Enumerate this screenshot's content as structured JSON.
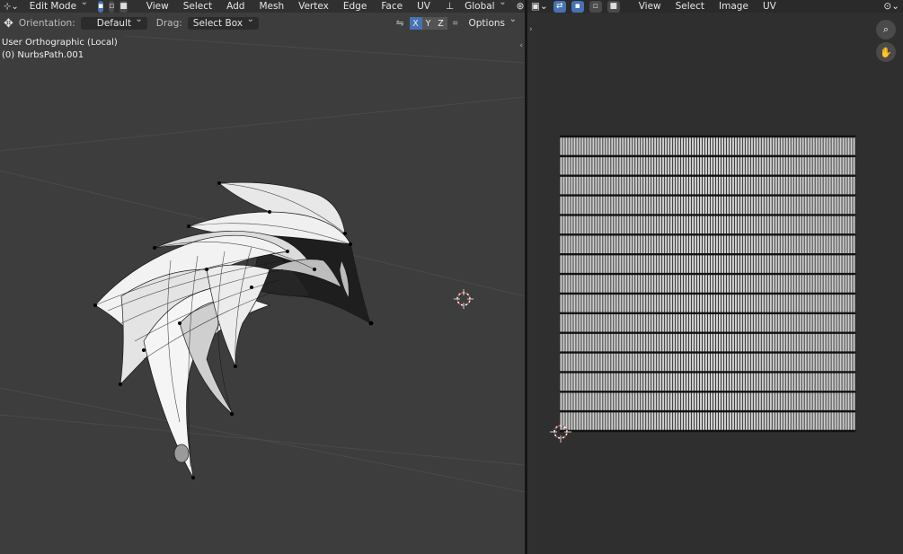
{
  "viewport3d": {
    "header": {
      "mode": "Edit Mode",
      "menus": [
        "View",
        "Select",
        "Add",
        "Mesh",
        "Vertex",
        "Edge",
        "Face",
        "UV"
      ],
      "transform_orientation": "Global"
    },
    "tool_header": {
      "orientation_label": "Orientation:",
      "orientation_value": "Default",
      "drag_label": "Drag:",
      "drag_value": "Select Box",
      "axes": [
        "X",
        "Y",
        "Z"
      ],
      "options_label": "Options"
    },
    "overlay": {
      "view_name": "User Orthographic (Local)",
      "object_name": "(0) NurbsPath.001"
    }
  },
  "uv_editor": {
    "menus": [
      "View",
      "Select",
      "Image",
      "UV"
    ]
  },
  "colors": {
    "viewport_bg": "#3d3d3d",
    "uv_bg": "#2f2f2f",
    "accent": "#4772b3",
    "cursor_red": "#e05050"
  }
}
